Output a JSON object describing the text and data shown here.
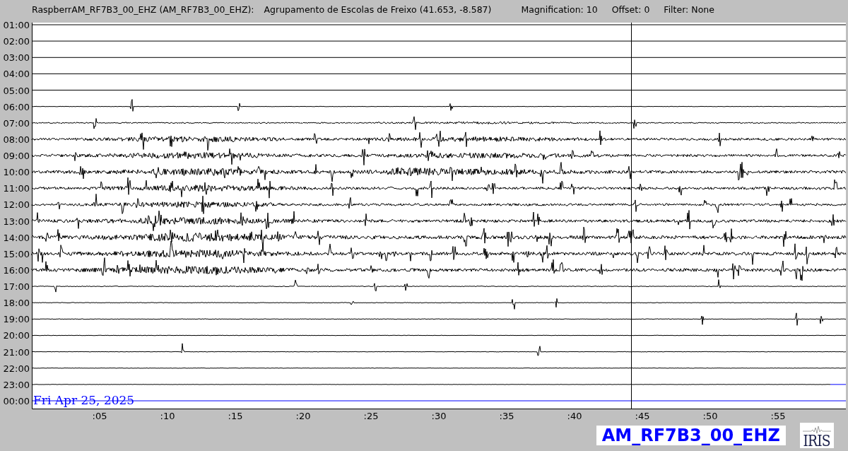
{
  "header": {
    "station": "RaspberrAM_RF7B3_00_EHZ (AM_RF7B3_00_EHZ):",
    "location": "Agrupamento de Escolas de Freixo (41.653, -8.587)",
    "magnification": "Magnification: 10",
    "offset": "Offset: 0",
    "filter": "Filter: None"
  },
  "helicorder": {
    "hours": [
      "01:00",
      "02:00",
      "03:00",
      "04:00",
      "05:00",
      "06:00",
      "07:00",
      "08:00",
      "09:00",
      "10:00",
      "11:00",
      "12:00",
      "13:00",
      "14:00",
      "15:00",
      "16:00",
      "17:00",
      "18:00",
      "19:00",
      "20:00",
      "21:00",
      "22:00",
      "23:00",
      "00:00"
    ],
    "date": "Fri Apr 25, 2025",
    "minute_ticks": [
      ":05",
      ":10",
      ":15",
      ":20",
      ":25",
      ":30",
      ":35",
      ":40",
      ":45",
      ":50",
      ":55"
    ]
  },
  "footer": {
    "channel": "AM_RF7B3_00_EHZ",
    "logo": "IRIS"
  }
}
